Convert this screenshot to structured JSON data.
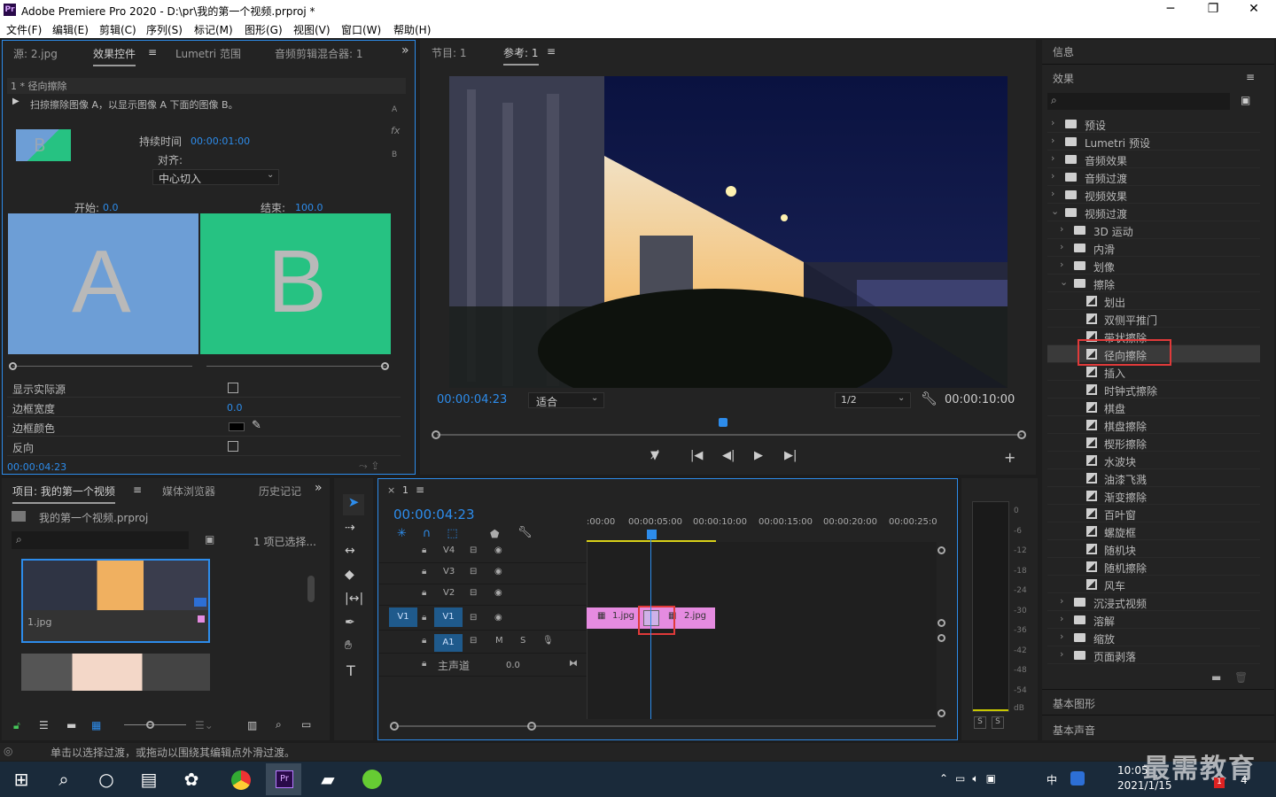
{
  "window": {
    "title": "Adobe Premiere Pro 2020 - D:\\pr\\我的第一个视频.prproj *",
    "logo": "Pr",
    "min": "─",
    "max": "❐",
    "close": "✕"
  },
  "menu": [
    "文件(F)",
    "编辑(E)",
    "剪辑(C)",
    "序列(S)",
    "标记(M)",
    "图形(G)",
    "视图(V)",
    "窗口(W)",
    "帮助(H)"
  ],
  "effect_controls": {
    "tabs": [
      "源: 2.jpg",
      "效果控件",
      "Lumetri 范围",
      "音频剪辑混合器: 1"
    ],
    "menu_icon": "≡",
    "more": "»",
    "header": "1 * 径向擦除",
    "description": "扫掠擦除图像 A，以显示图像 A 下面的图像 B。",
    "side_a": "A",
    "side_fx": "fx",
    "side_b": "B",
    "thumb_letter": "B",
    "duration_label": "持续时间",
    "duration_value": "00:00:01:00",
    "align_label": "对齐:",
    "align_value": "中心切入",
    "start_label": "开始:",
    "start_value": "0.0",
    "end_label": "结束:",
    "end_value": "100.0",
    "preview_a": "A",
    "preview_b": "B",
    "props": [
      {
        "label": "显示实际源",
        "value": ""
      },
      {
        "label": "边框宽度",
        "value": "0.0"
      },
      {
        "label": "边框颜色",
        "value": ""
      },
      {
        "label": "反向",
        "value": ""
      }
    ],
    "timecode": "00:00:04:23",
    "colors": {
      "a": "#6d9ed6",
      "b": "#26c282"
    }
  },
  "program_monitor": {
    "tabs": [
      "节目: 1",
      "参考: 1"
    ],
    "menu_icon": "≡",
    "timecode": "00:00:04:23",
    "fit": "适合",
    "resolution": "1/2",
    "duration": "00:00:10:00",
    "playhead_fraction": 0.49
  },
  "effects_panel": {
    "info_tab": "信息",
    "title": "效果",
    "menu_icon": "≡",
    "search_placeholder": "",
    "items": [
      {
        "label": "预设",
        "type": "folder",
        "level": 0,
        "open": false
      },
      {
        "label": "Lumetri 预设",
        "type": "folder",
        "level": 0,
        "open": false
      },
      {
        "label": "音频效果",
        "type": "folder",
        "level": 0,
        "open": false
      },
      {
        "label": "音频过渡",
        "type": "folder",
        "level": 0,
        "open": false
      },
      {
        "label": "视频效果",
        "type": "folder",
        "level": 0,
        "open": false
      },
      {
        "label": "视频过渡",
        "type": "folder",
        "level": 0,
        "open": true
      },
      {
        "label": "3D 运动",
        "type": "folder",
        "level": 1,
        "open": false
      },
      {
        "label": "内滑",
        "type": "folder",
        "level": 1,
        "open": false
      },
      {
        "label": "划像",
        "type": "folder",
        "level": 1,
        "open": false
      },
      {
        "label": "擦除",
        "type": "folder",
        "level": 1,
        "open": true
      },
      {
        "label": "划出",
        "type": "effect",
        "level": 2
      },
      {
        "label": "双侧平推门",
        "type": "effect",
        "level": 2
      },
      {
        "label": "带状擦除",
        "type": "effect",
        "level": 2
      },
      {
        "label": "径向擦除",
        "type": "effect",
        "level": 2,
        "selected": true
      },
      {
        "label": "插入",
        "type": "effect",
        "level": 2
      },
      {
        "label": "时钟式擦除",
        "type": "effect",
        "level": 2
      },
      {
        "label": "棋盘",
        "type": "effect",
        "level": 2
      },
      {
        "label": "棋盘擦除",
        "type": "effect",
        "level": 2
      },
      {
        "label": "楔形擦除",
        "type": "effect",
        "level": 2
      },
      {
        "label": "水波块",
        "type": "effect",
        "level": 2
      },
      {
        "label": "油漆飞溅",
        "type": "effect",
        "level": 2
      },
      {
        "label": "渐变擦除",
        "type": "effect",
        "level": 2
      },
      {
        "label": "百叶窗",
        "type": "effect",
        "level": 2
      },
      {
        "label": "螺旋框",
        "type": "effect",
        "level": 2
      },
      {
        "label": "随机块",
        "type": "effect",
        "level": 2
      },
      {
        "label": "随机擦除",
        "type": "effect",
        "level": 2
      },
      {
        "label": "风车",
        "type": "effect",
        "level": 2
      },
      {
        "label": "沉浸式视频",
        "type": "folder",
        "level": 1,
        "open": false
      },
      {
        "label": "溶解",
        "type": "folder",
        "level": 1,
        "open": false
      },
      {
        "label": "缩放",
        "type": "folder",
        "level": 1,
        "open": false
      },
      {
        "label": "页面剥落",
        "type": "folder",
        "level": 1,
        "open": false
      }
    ],
    "basic_graphics": "基本图形",
    "basic_sound": "基本声音"
  },
  "project_panel": {
    "tabs": [
      "项目: 我的第一个视频",
      "媒体浏览器",
      "历史记记"
    ],
    "menu_icon": "≡",
    "more": "»",
    "file": "我的第一个视频.prproj",
    "selected": "1 项已选择...",
    "clip1": "1.jpg"
  },
  "timeline": {
    "tab": "1",
    "close": "×",
    "menu_icon": "≡",
    "timecode": "00:00:04:23",
    "ruler": [
      ":00:00",
      "00:00:05:00",
      "00:00:10:00",
      "00:00:15:00",
      "00:00:20:00",
      "00:00:25:00"
    ],
    "tracks": [
      "V4",
      "V3",
      "V2",
      "V1",
      "A1"
    ],
    "source_v": "V1",
    "source_a": "A1",
    "master": "主声道",
    "master_value": "0.0",
    "mute": "M",
    "solo": "S",
    "clip1": "1.jpg",
    "clip2": "2.jpg"
  },
  "meter": {
    "ticks": [
      "0",
      "-6",
      "-12",
      "-18",
      "-24",
      "-30",
      "-36",
      "-42",
      "-48",
      "-54",
      "dB"
    ],
    "s1": "S",
    "s2": "S"
  },
  "status_bar": "单击以选择过渡，或拖动以围绕其编辑点外滑过渡。",
  "taskbar": {
    "time": "10:05",
    "date": "2021/1/15",
    "ime": "中",
    "badge": "1",
    "notif": "4",
    "watermark": "最需教育"
  }
}
